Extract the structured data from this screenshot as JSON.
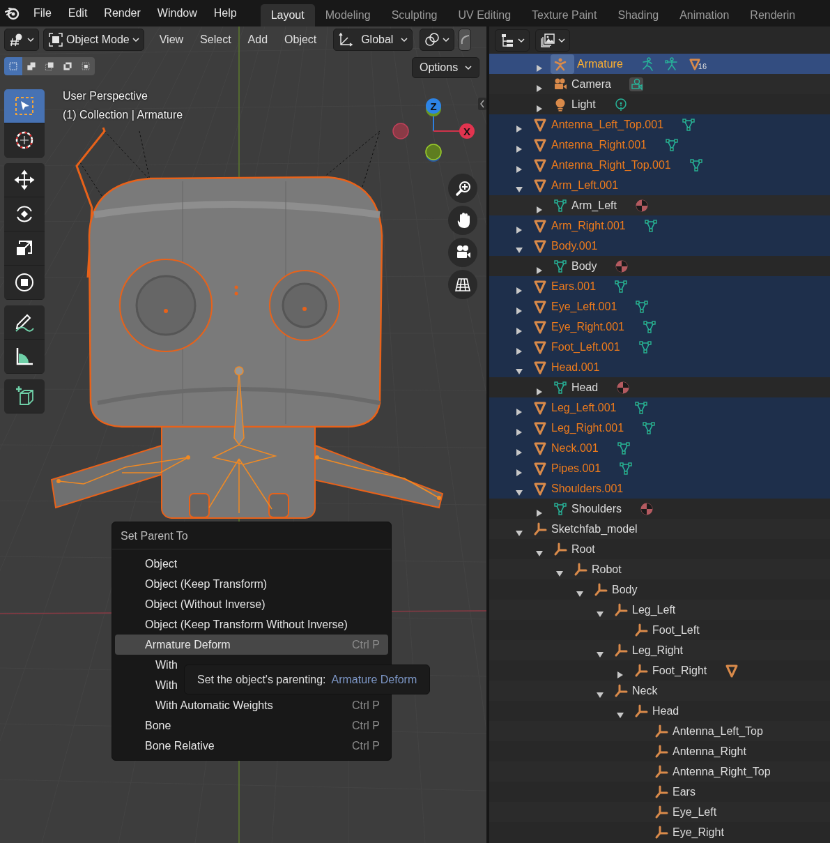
{
  "topbar": {
    "menus": [
      "File",
      "Edit",
      "Render",
      "Window",
      "Help"
    ],
    "workspaces": [
      {
        "label": "Layout",
        "selected": true
      },
      {
        "label": "Modeling",
        "selected": false
      },
      {
        "label": "Sculpting",
        "selected": false
      },
      {
        "label": "UV Editing",
        "selected": false
      },
      {
        "label": "Texture Paint",
        "selected": false
      },
      {
        "label": "Shading",
        "selected": false
      },
      {
        "label": "Animation",
        "selected": false
      },
      {
        "label": "Renderin",
        "selected": false
      }
    ]
  },
  "viewport": {
    "mode": "Object Mode",
    "menus": [
      "View",
      "Select",
      "Add",
      "Object"
    ],
    "orientation": "Global",
    "options": "Options",
    "select_modes": [
      {
        "kind": "new",
        "selected": true
      },
      {
        "kind": "extend",
        "selected": false
      },
      {
        "kind": "subtract",
        "selected": false
      },
      {
        "kind": "invert",
        "selected": false
      },
      {
        "kind": "intersect",
        "selected": false
      }
    ],
    "tool_groups": [
      [
        {
          "kind": "select_box",
          "selected": true
        },
        {
          "kind": "cursor",
          "selected": false
        }
      ],
      [
        {
          "kind": "move",
          "selected": false
        },
        {
          "kind": "rotate",
          "selected": false
        },
        {
          "kind": "scale",
          "selected": false
        },
        {
          "kind": "transform",
          "selected": false
        }
      ],
      [
        {
          "kind": "annotate",
          "selected": false
        },
        {
          "kind": "measure",
          "selected": false
        }
      ],
      [
        {
          "kind": "add_cube",
          "selected": false
        }
      ]
    ],
    "overlay_text": [
      "User Perspective",
      "(1) Collection | Armature"
    ],
    "gizmo": {
      "z_label": "Z",
      "x_label": "X"
    },
    "nav_buttons": [
      {
        "kind": "zoom"
      },
      {
        "kind": "pan"
      },
      {
        "kind": "camera"
      },
      {
        "kind": "projection"
      }
    ]
  },
  "context_menu": {
    "title": "Set Parent To",
    "items": [
      {
        "label": "Object",
        "kind": "option",
        "selected": false
      },
      {
        "label": "Object (Keep Transform)",
        "kind": "option",
        "selected": false
      },
      {
        "label": "Object (Without Inverse)",
        "kind": "option",
        "selected": false
      },
      {
        "label": "Object (Keep Transform Without Inverse)",
        "kind": "option",
        "selected": false
      },
      {
        "label": "Armature Deform",
        "shortcut": "Ctrl P",
        "kind": "option",
        "selected": true
      },
      {
        "label": "With",
        "kind": "sub_option",
        "selected": false
      },
      {
        "label": "With",
        "kind": "sub_option",
        "selected": false
      },
      {
        "label": "With Automatic Weights",
        "shortcut": "Ctrl P",
        "kind": "sub_option",
        "selected": false
      },
      {
        "label": "Bone",
        "shortcut": "Ctrl P",
        "kind": "option",
        "selected": false
      },
      {
        "label": "Bone Relative",
        "shortcut": "Ctrl P",
        "kind": "option",
        "selected": false
      }
    ]
  },
  "tooltip": {
    "text": "Set the object's parenting:",
    "value": "Armature Deform"
  },
  "outliner": {
    "collection_contents": [
      {
        "name": "Armature",
        "kind": "armature_object",
        "expanded": false,
        "selected": true,
        "active": true,
        "extras": [
          {
            "kind": "armature_data"
          },
          {
            "kind": "pose"
          },
          {
            "kind": "vertex_groups",
            "count": "16"
          }
        ]
      },
      {
        "name": "Camera",
        "kind": "camera_object",
        "expanded": false,
        "selected": false,
        "active": false,
        "extras": [
          {
            "kind": "camera_data"
          }
        ]
      },
      {
        "name": "Light",
        "kind": "light_object",
        "expanded": false,
        "selected": false,
        "active": false,
        "extras": [
          {
            "kind": "light_data"
          }
        ]
      }
    ],
    "objects": [
      {
        "name": "Antenna_Left_Top.001",
        "kind": "mesh_object",
        "expanded": false,
        "selected": true,
        "active": false,
        "extras": [
          {
            "kind": "mesh_data"
          }
        ]
      },
      {
        "name": "Antenna_Right.001",
        "kind": "mesh_object",
        "expanded": false,
        "selected": true,
        "active": false,
        "extras": [
          {
            "kind": "mesh_data"
          }
        ]
      },
      {
        "name": "Antenna_Right_Top.001",
        "kind": "mesh_object",
        "expanded": false,
        "selected": true,
        "active": false,
        "extras": [
          {
            "kind": "mesh_data"
          }
        ]
      },
      {
        "name": "Arm_Left.001",
        "kind": "mesh_object",
        "expanded": true,
        "selected": true,
        "active": false,
        "children": [
          {
            "name": "Arm_Left",
            "kind": "mesh_data",
            "expanded": false,
            "selected": false,
            "active": false,
            "extras": [
              {
                "kind": "material"
              }
            ]
          }
        ]
      },
      {
        "name": "Arm_Right.001",
        "kind": "mesh_object",
        "expanded": false,
        "selected": true,
        "active": false,
        "extras": [
          {
            "kind": "mesh_data"
          }
        ]
      },
      {
        "name": "Body.001",
        "kind": "mesh_object",
        "expanded": true,
        "selected": true,
        "active": false,
        "children": [
          {
            "name": "Body",
            "kind": "mesh_data",
            "expanded": false,
            "selected": false,
            "active": false,
            "extras": [
              {
                "kind": "material"
              }
            ]
          }
        ]
      },
      {
        "name": "Ears.001",
        "kind": "mesh_object",
        "expanded": false,
        "selected": true,
        "active": false,
        "extras": [
          {
            "kind": "mesh_data"
          }
        ]
      },
      {
        "name": "Eye_Left.001",
        "kind": "mesh_object",
        "expanded": false,
        "selected": true,
        "active": false,
        "extras": [
          {
            "kind": "mesh_data"
          }
        ]
      },
      {
        "name": "Eye_Right.001",
        "kind": "mesh_object",
        "expanded": false,
        "selected": true,
        "active": false,
        "extras": [
          {
            "kind": "mesh_data"
          }
        ]
      },
      {
        "name": "Foot_Left.001",
        "kind": "mesh_object",
        "expanded": false,
        "selected": true,
        "active": false,
        "extras": [
          {
            "kind": "mesh_data"
          }
        ]
      },
      {
        "name": "Head.001",
        "kind": "mesh_object",
        "expanded": true,
        "selected": true,
        "active": false,
        "children": [
          {
            "name": "Head",
            "kind": "mesh_data",
            "expanded": false,
            "selected": false,
            "active": false,
            "extras": [
              {
                "kind": "material"
              }
            ]
          }
        ]
      },
      {
        "name": "Leg_Left.001",
        "kind": "mesh_object",
        "expanded": false,
        "selected": true,
        "active": false,
        "extras": [
          {
            "kind": "mesh_data"
          }
        ]
      },
      {
        "name": "Leg_Right.001",
        "kind": "mesh_object",
        "expanded": false,
        "selected": true,
        "active": false,
        "extras": [
          {
            "kind": "mesh_data"
          }
        ]
      },
      {
        "name": "Neck.001",
        "kind": "mesh_object",
        "expanded": false,
        "selected": true,
        "active": false,
        "extras": [
          {
            "kind": "mesh_data"
          }
        ]
      },
      {
        "name": "Pipes.001",
        "kind": "mesh_object",
        "expanded": false,
        "selected": true,
        "active": false,
        "extras": [
          {
            "kind": "mesh_data"
          }
        ]
      },
      {
        "name": "Shoulders.001",
        "kind": "mesh_object",
        "expanded": true,
        "selected": true,
        "active": false,
        "children": [
          {
            "name": "Shoulders",
            "kind": "mesh_data",
            "expanded": false,
            "selected": false,
            "active": false,
            "extras": [
              {
                "kind": "material"
              }
            ]
          }
        ]
      },
      {
        "name": "Sketchfab_model",
        "kind": "empty",
        "expanded": true,
        "selected": false,
        "active": false,
        "children": [
          {
            "name": "Root",
            "kind": "empty",
            "expanded": true,
            "selected": false,
            "active": false,
            "children": [
              {
                "name": "Robot",
                "kind": "empty",
                "expanded": true,
                "selected": false,
                "active": false,
                "children": [
                  {
                    "name": "Body",
                    "kind": "empty",
                    "expanded": true,
                    "selected": false,
                    "active": false,
                    "children": [
                      {
                        "name": "Leg_Left",
                        "kind": "empty",
                        "expanded": true,
                        "selected": false,
                        "active": false,
                        "children": [
                          {
                            "name": "Foot_Left",
                            "kind": "empty",
                            "selected": false,
                            "active": false
                          }
                        ]
                      },
                      {
                        "name": "Leg_Right",
                        "kind": "empty",
                        "expanded": true,
                        "selected": false,
                        "active": false,
                        "children": [
                          {
                            "name": "Foot_Right",
                            "kind": "empty",
                            "expanded": false,
                            "selected": false,
                            "active": false,
                            "extras": [
                              {
                                "kind": "mesh_object"
                              }
                            ]
                          }
                        ]
                      },
                      {
                        "name": "Neck",
                        "kind": "empty",
                        "expanded": true,
                        "selected": false,
                        "active": false,
                        "children": [
                          {
                            "name": "Head",
                            "kind": "empty",
                            "expanded": true,
                            "selected": false,
                            "active": false,
                            "children": [
                              {
                                "name": "Antenna_Left_Top",
                                "kind": "empty",
                                "selected": false,
                                "active": false
                              },
                              {
                                "name": "Antenna_Right",
                                "kind": "empty",
                                "selected": false,
                                "active": false
                              },
                              {
                                "name": "Antenna_Right_Top",
                                "kind": "empty",
                                "selected": false,
                                "active": false
                              },
                              {
                                "name": "Ears",
                                "kind": "empty",
                                "selected": false,
                                "active": false
                              },
                              {
                                "name": "Eye_Left",
                                "kind": "empty",
                                "selected": false,
                                "active": false
                              },
                              {
                                "name": "Eye_Right",
                                "kind": "empty",
                                "selected": false,
                                "active": false
                              }
                            ]
                          }
                        ]
                      }
                    ]
                  }
                ]
              }
            ]
          }
        ]
      }
    ]
  }
}
